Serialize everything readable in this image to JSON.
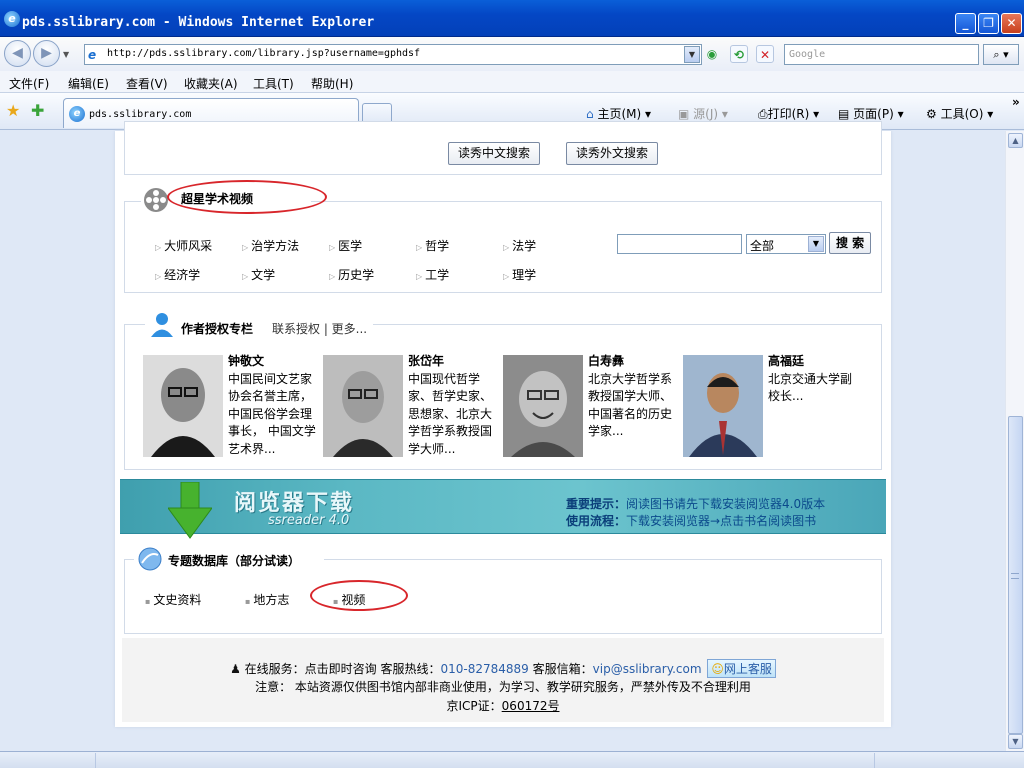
{
  "window": {
    "title": "pds.sslibrary.com - Windows Internet Explorer",
    "minimize": "_",
    "restore": "❐",
    "close": "✕"
  },
  "nav": {
    "url": "http://pds.sslibrary.com/library.jsp?username=gphdsf",
    "search_placeholder": "Google"
  },
  "menu": [
    "文件(F)",
    "编辑(E)",
    "查看(V)",
    "收藏夹(A)",
    "工具(T)",
    "帮助(H)"
  ],
  "tab": {
    "title": "pds.sslibrary.com"
  },
  "commands": {
    "home": "主页(M)",
    "feeds": "源(J)",
    "print": "打印(R)",
    "page": "页面(P)",
    "tools": "工具(O)",
    "more": "»"
  },
  "search_buttons": {
    "chinese": "读秀中文搜索",
    "foreign": "读秀外文搜索"
  },
  "video": {
    "heading": "超星学术视频",
    "categories": [
      "大师风采",
      "治学方法",
      "医学",
      "哲学",
      "法学",
      "经济学",
      "文学",
      "历史学",
      "工学",
      "理学"
    ],
    "select": "全部",
    "search_label": "搜 索"
  },
  "authors": {
    "heading": "作者授权专栏",
    "links": "联系授权 | 更多...",
    "items": [
      {
        "name": "钟敬文",
        "desc": "中国民间文艺家协会名誉主席，中国民俗学会理事长， 中国文学艺术界..."
      },
      {
        "name": "张岱年",
        "desc": "中国现代哲学家、哲学史家、思想家、北京大学哲学系教授国学大师..."
      },
      {
        "name": "白寿彝",
        "desc": "北京大学哲学系教授国学大师、中国著名的历史学家..."
      },
      {
        "name": "高福廷",
        "desc": "北京交通大学副校长..."
      }
    ]
  },
  "banner": {
    "title": "阅览器下载",
    "subtitle": "ssreader 4.0",
    "tip_label": "重要提示：",
    "tip_text": "阅读图书请先下载安装阅览器4.0版本",
    "flow_label": "使用流程：",
    "flow_text": "下载安装阅览器→点击书名阅读图书"
  },
  "special_db": {
    "heading": "专题数据库（部分试读）",
    "items": [
      "文史资料",
      "地方志",
      "视频"
    ]
  },
  "footer": {
    "service_label": "在线服务：点击即时咨询 客服热线：",
    "phone": "010-82784889",
    "mail_label": " 客服信箱：",
    "email": "vip@sslibrary.com",
    "chat_button": "网上客服",
    "notice": "注意： 本站资源仅供图书馆内部非商业使用，为学习、教学研究服务，严禁外传及不合理利用",
    "icp_label": "京ICP证：",
    "icp": "060172号"
  },
  "colors": {
    "accent": "#0447c5",
    "highlight": "#d8262b",
    "link": "#2a5ea8"
  }
}
